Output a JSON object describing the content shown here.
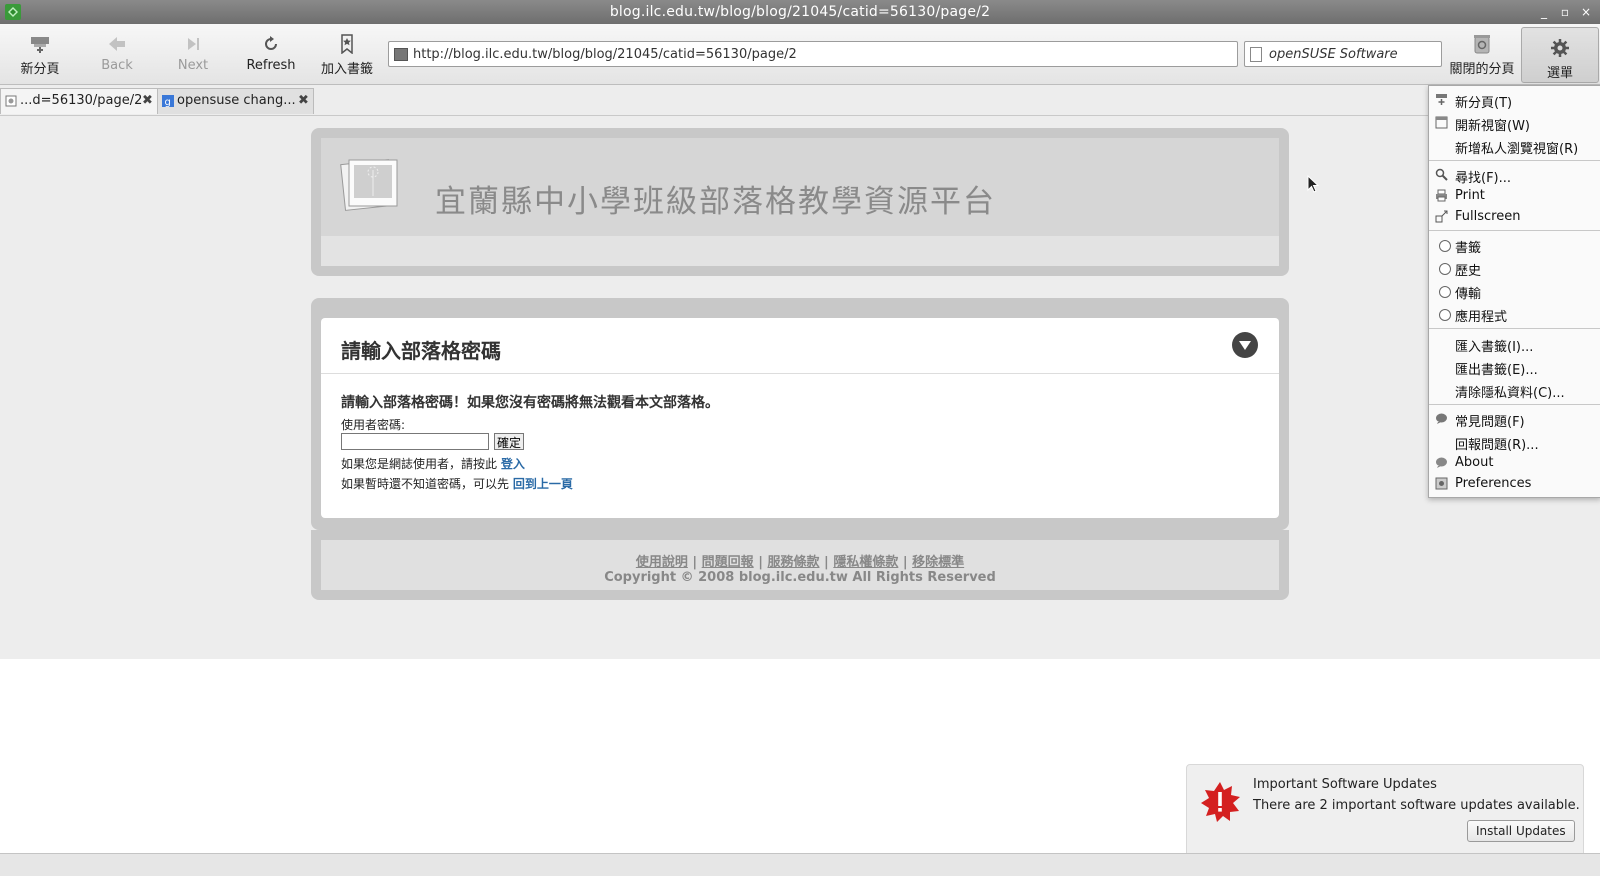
{
  "window": {
    "title": "blog.ilc.edu.tw/blog/blog/21045/catid=56130/page/2",
    "controls": [
      "_",
      "▫",
      "×"
    ]
  },
  "toolbar": {
    "new_tab": "新分頁",
    "back": "Back",
    "next": "Next",
    "refresh": "Refresh",
    "bookmark": "加入書籤",
    "url": "http://blog.ilc.edu.tw/blog/blog/21045/catid=56130/page/2",
    "search_value": "openSUSE Software",
    "closed_tabs": "關閉的分頁",
    "menu": "選單"
  },
  "tabs": [
    {
      "label": "...d=56130/page/2",
      "active": true,
      "close": "✖"
    },
    {
      "label": "opensuse chang...",
      "active": false,
      "close": "✖"
    }
  ],
  "page": {
    "site_title": "宜蘭縣中小學班級部落格教學資源平台",
    "login": {
      "heading": "請輸入部落格密碼",
      "notice": "請輸入部落格密碼！如果您沒有密碼將無法觀看本文部落格。",
      "password_label": "使用者密碼:",
      "password_value": "",
      "ok_button": "確定",
      "line1_text": "如果您是網誌使用者，請按此 ",
      "line1_link": "登入",
      "line2_text": "如果暫時還不知道密碼，可以先 ",
      "line2_link": "回到上一頁"
    },
    "footer": {
      "links": [
        "使用說明",
        "問題回報",
        "服務條款",
        "隱私權條款",
        "移除標準"
      ],
      "separator": " | ",
      "copyright": "Copyright © 2008 blog.ilc.edu.tw All Rights Reserved"
    }
  },
  "menu": {
    "items": [
      {
        "label": "新分頁(T)",
        "icon": "new-tab-icon"
      },
      {
        "label": "開新視窗(W)",
        "icon": "new-window-icon"
      },
      {
        "label": "新增私人瀏覽視窗(R)",
        "icon": ""
      },
      {
        "label": "尋找(F)...",
        "icon": "search-icon"
      },
      {
        "label": "Print",
        "icon": "print-icon"
      },
      {
        "label": "Fullscreen",
        "icon": "fullscreen-icon"
      },
      {
        "label": "書籤",
        "icon": "radio"
      },
      {
        "label": "歷史",
        "icon": "radio"
      },
      {
        "label": "傳輸",
        "icon": "radio"
      },
      {
        "label": "應用程式",
        "icon": "radio"
      },
      {
        "label": "匯入書籤(I)...",
        "icon": ""
      },
      {
        "label": "匯出書籤(E)...",
        "icon": ""
      },
      {
        "label": "清除隱私資料(C)...",
        "icon": ""
      },
      {
        "label": "常見問題(F)",
        "icon": "help-icon"
      },
      {
        "label": "回報問題(R)...",
        "icon": ""
      },
      {
        "label": "About",
        "icon": "about-icon"
      },
      {
        "label": "Preferences",
        "icon": "preferences-icon"
      }
    ]
  },
  "notification": {
    "title": "Important Software Updates",
    "body": "There are 2 important software updates available.",
    "button": "Install Updates"
  },
  "colors": {
    "link": "#2a6aa6",
    "accent_red": "#d42020"
  }
}
